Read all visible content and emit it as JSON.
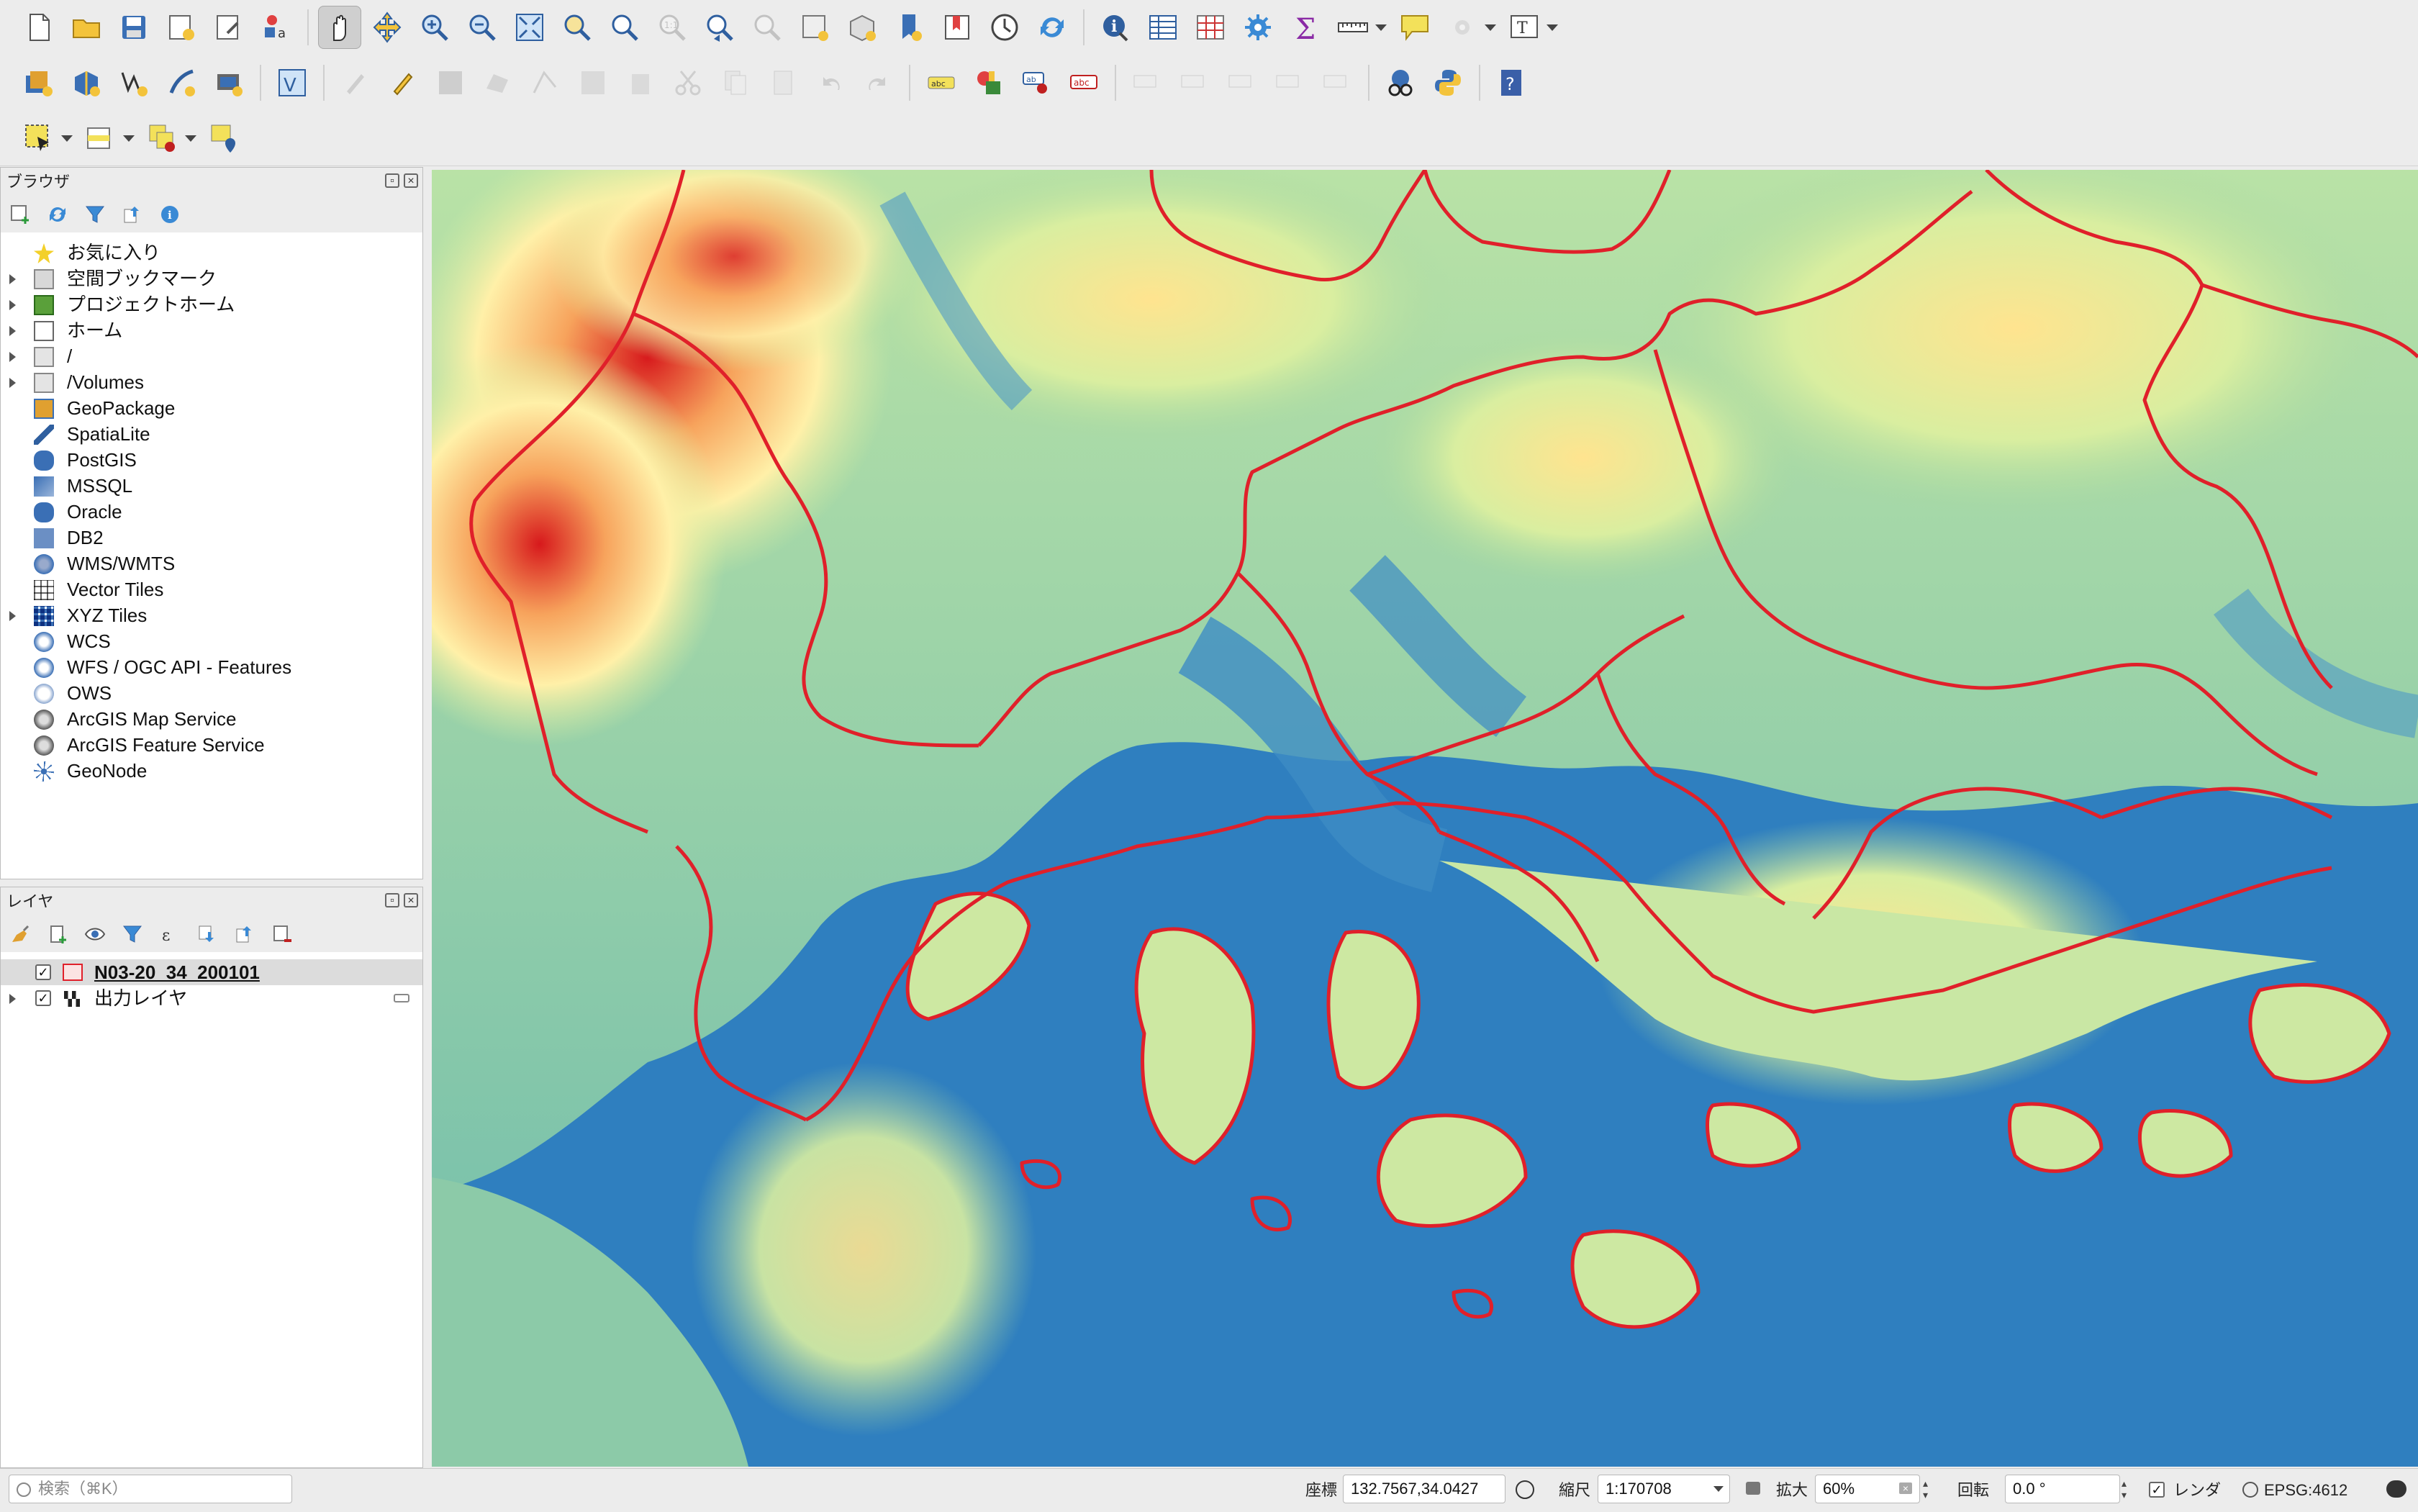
{
  "browser_panel": {
    "title": "ブラウザ",
    "items": [
      {
        "label": "お気に入り",
        "icon": "star-icon",
        "expandable": false
      },
      {
        "label": "空間ブックマーク",
        "icon": "bookmark-icon",
        "expandable": true
      },
      {
        "label": "プロジェクトホーム",
        "icon": "project-home-icon",
        "expandable": true
      },
      {
        "label": "ホーム",
        "icon": "home-folder-icon",
        "expandable": true
      },
      {
        "label": "/",
        "icon": "folder-icon",
        "expandable": true
      },
      {
        "label": "/Volumes",
        "icon": "folder-icon",
        "expandable": true
      },
      {
        "label": "GeoPackage",
        "icon": "geopackage-icon",
        "expandable": false
      },
      {
        "label": "SpatiaLite",
        "icon": "spatialite-icon",
        "expandable": false
      },
      {
        "label": "PostGIS",
        "icon": "postgis-icon",
        "expandable": false
      },
      {
        "label": "MSSQL",
        "icon": "mssql-icon",
        "expandable": false
      },
      {
        "label": "Oracle",
        "icon": "oracle-icon",
        "expandable": false
      },
      {
        "label": "DB2",
        "icon": "db2-icon",
        "expandable": false
      },
      {
        "label": "WMS/WMTS",
        "icon": "wms-globe-icon",
        "expandable": false
      },
      {
        "label": "Vector Tiles",
        "icon": "vector-tiles-icon",
        "expandable": false
      },
      {
        "label": "XYZ Tiles",
        "icon": "xyz-tiles-icon",
        "expandable": true
      },
      {
        "label": "WCS",
        "icon": "wcs-globe-icon",
        "expandable": false
      },
      {
        "label": "WFS / OGC API - Features",
        "icon": "wfs-globe-icon",
        "expandable": false
      },
      {
        "label": "OWS",
        "icon": "ows-globe-icon",
        "expandable": false
      },
      {
        "label": "ArcGIS Map Service",
        "icon": "arcgis-map-icon",
        "expandable": false
      },
      {
        "label": "ArcGIS Feature Service",
        "icon": "arcgis-feature-icon",
        "expandable": false
      },
      {
        "label": "GeoNode",
        "icon": "geonode-icon",
        "expandable": false
      }
    ]
  },
  "layers_panel": {
    "title": "レイヤ",
    "layers": [
      {
        "label": "N03-20_34_200101",
        "checked": true,
        "selected": true
      },
      {
        "label": "出力レイヤ",
        "checked": true,
        "selected": false
      }
    ]
  },
  "statusbar": {
    "search_placeholder": "検索（⌘K）",
    "coord_label": "座標",
    "coord_value": "132.7567,34.0427",
    "scale_label": "縮尺",
    "scale_value": "1:170708",
    "magnifier_label": "拡大",
    "magnifier_value": "60%",
    "rotation_label": "回転",
    "rotation_value": "0.0 °",
    "render_label": "レンダ",
    "crs_label": "EPSG:4612"
  },
  "colors": {
    "boundary": "#e0202a",
    "sea": "#2f7fbf",
    "lowland": "#d9eea0",
    "highland": "#d7191c"
  }
}
